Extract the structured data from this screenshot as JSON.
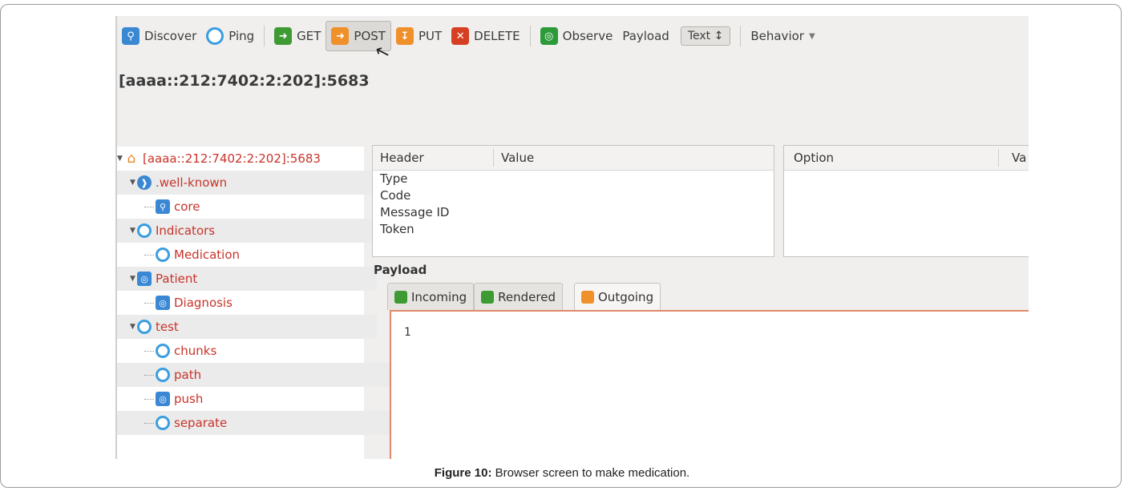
{
  "toolbar": {
    "discover": "Discover",
    "ping": "Ping",
    "get": "GET",
    "post": "POST",
    "put": "PUT",
    "delete": "DELETE",
    "observe": "Observe",
    "payload_label": "Payload",
    "payload_value": "Text",
    "behavior": "Behavior"
  },
  "address": "[aaaa::212:7402:2:202]:5683",
  "tree": {
    "root": "[aaaa::212:7402:2:202]:5683",
    "wellknown": ".well-known",
    "core": "core",
    "indicators": "Indicators",
    "medication": "Medication",
    "patient": "Patient",
    "diagnosis": "Diagnosis",
    "test": "test",
    "chunks": "chunks",
    "path": "path",
    "push": "push",
    "separate": "separate"
  },
  "header_table": {
    "col_header": "Header",
    "col_value": "Value",
    "rows": [
      "Type",
      "Code",
      "Message ID",
      "Token"
    ]
  },
  "option_table": {
    "col_option": "Option",
    "col_value": "Va"
  },
  "payload": {
    "label": "Payload",
    "tabs": {
      "incoming": "Incoming",
      "rendered": "Rendered",
      "outgoing": "Outgoing"
    },
    "line_number": "1"
  },
  "caption": {
    "prefix": "Figure 10:",
    "text": " Browser screen to make medication."
  },
  "colors": {
    "resource_text": "#c8332a",
    "accent_blue": "#3a88d4",
    "editor_border": "#e08a6a"
  }
}
